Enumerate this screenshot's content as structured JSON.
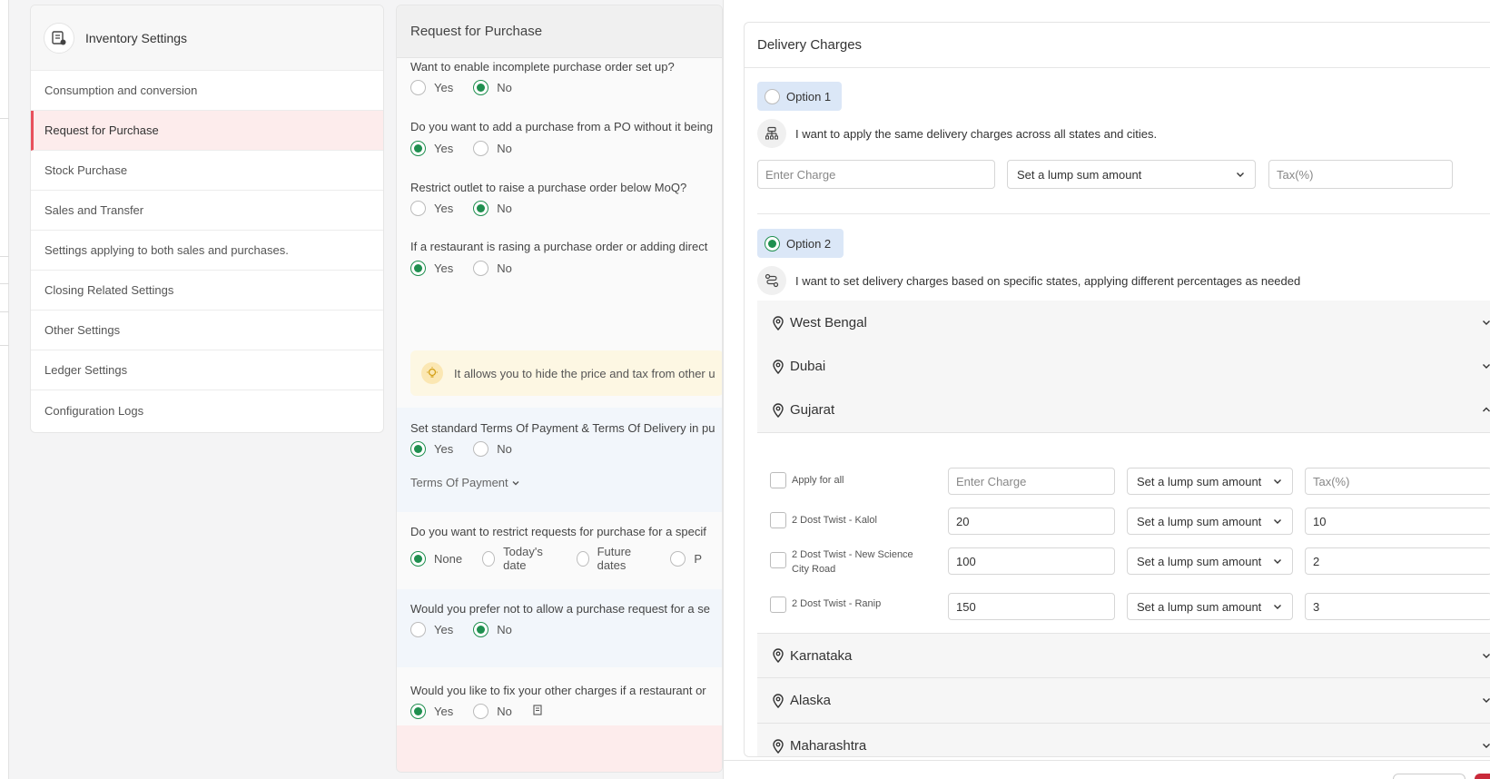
{
  "sidebar": {
    "title": "Inventory Settings",
    "items": [
      {
        "label": "Consumption and conversion",
        "active": false
      },
      {
        "label": "Request for Purchase",
        "active": true
      },
      {
        "label": "Stock Purchase",
        "active": false
      },
      {
        "label": "Sales and Transfer",
        "active": false
      },
      {
        "label": "Settings applying to both sales and purchases.",
        "active": false
      },
      {
        "label": "Closing Related Settings",
        "active": false
      },
      {
        "label": "Other Settings",
        "active": false
      },
      {
        "label": "Ledger Settings",
        "active": false
      },
      {
        "label": "Configuration Logs",
        "active": false
      }
    ]
  },
  "middle": {
    "title": "Request for Purchase",
    "q1": "Want to enable incomplete purchase order set up?",
    "q2": "Do you want to add a purchase from a PO without it being",
    "q3": "Restrict outlet to raise a purchase order below MoQ?",
    "q4": "If a restaurant is rasing a purchase order or adding direct",
    "tip": "It allows you to hide the price and tax from other u",
    "q5": "Set standard Terms Of Payment & Terms Of Delivery in pu",
    "terms_link": "Terms Of Payment",
    "q6": "Do you want to restrict requests for purchase for a specif",
    "q7": "Would you prefer not to allow a purchase request for a se",
    "q8": "Would you like to fix your other charges if a restaurant or",
    "yes": "Yes",
    "no": "No",
    "none": "None",
    "today": "Today's date",
    "future": "Future dates",
    "p": "P"
  },
  "drawer": {
    "title": "Delivery Charges",
    "option1": {
      "label": "Option 1",
      "desc": "I want to apply the same delivery charges across all states and cities.",
      "charge_placeholder": "Enter Charge",
      "mode": "Set a lump sum amount",
      "tax_placeholder": "Tax(%)"
    },
    "option2": {
      "label": "Option 2",
      "desc": "I want to set delivery charges based on specific states, applying different percentages as needed"
    },
    "states": [
      "West Bengal",
      "Dubai",
      "Gujarat",
      "Karnataka",
      "Alaska",
      "Maharashtra"
    ],
    "gujarat": {
      "apply_all": "Apply for all",
      "charge_placeholder": "Enter Charge",
      "mode": "Set a lump sum amount",
      "tax_placeholder": "Tax(%)",
      "outlets": [
        {
          "name": "2 Dost Twist - Kalol",
          "charge": "20",
          "mode": "Set a lump sum amount",
          "tax": "10"
        },
        {
          "name": "2 Dost Twist - New Science City Road",
          "charge": "100",
          "mode": "Set a lump sum amount",
          "tax": "2"
        },
        {
          "name": "2 Dost Twist - Ranip",
          "charge": "150",
          "mode": "Set a lump sum amount",
          "tax": "3"
        }
      ]
    }
  }
}
